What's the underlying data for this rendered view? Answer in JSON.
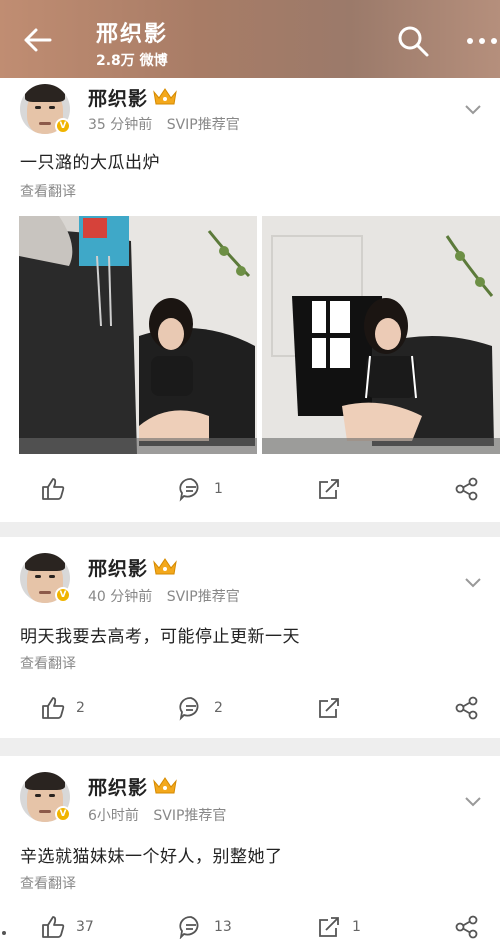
{
  "header": {
    "title": "邢织影",
    "subtitle": "2.8万 微博"
  },
  "posts": [
    {
      "author": "邢织影",
      "time": "35 分钟前",
      "source": "SVIP推荐官",
      "text": "一只潞的大瓜出炉",
      "translate": "查看翻译",
      "likes": "",
      "comments": "1",
      "reposts": ""
    },
    {
      "author": "邢织影",
      "time": "40 分钟前",
      "source": "SVIP推荐官",
      "text": "明天我要去高考，可能停止更新一天",
      "translate": "查看翻译",
      "likes": "2",
      "comments": "2",
      "reposts": ""
    },
    {
      "author": "邢织影",
      "time": "6小时前",
      "source": "SVIP推荐官",
      "text": "辛选就猫妹妹一个好人，别整她了",
      "translate": "查看翻译",
      "likes": "37",
      "comments": "13",
      "reposts": "1"
    }
  ],
  "colors": {
    "header_bg": "#a87c66",
    "badge": "#f0b400",
    "separator": "#eeeeee"
  },
  "icons": [
    "back-arrow-icon",
    "search-icon",
    "more-icon",
    "crown-icon",
    "chevron-down-icon",
    "like-icon",
    "comment-icon",
    "repost-icon",
    "share-icon"
  ]
}
